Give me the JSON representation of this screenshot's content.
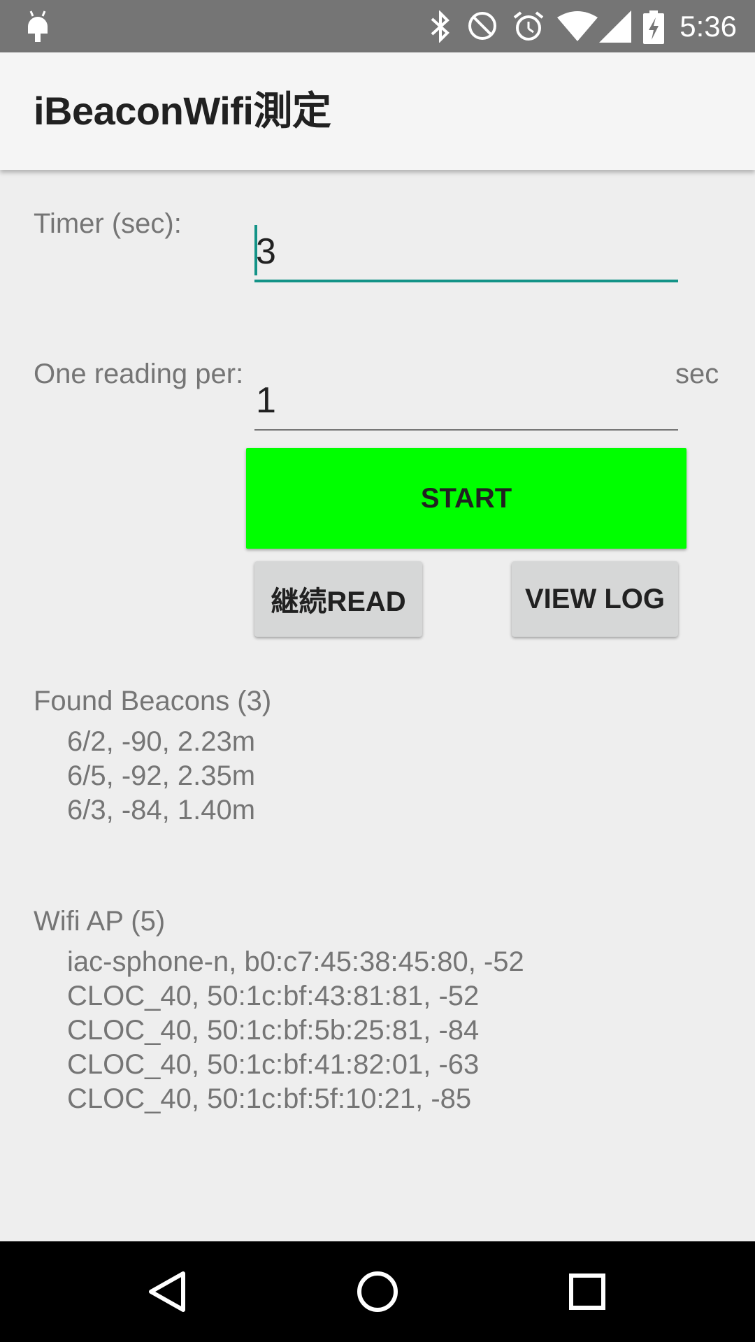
{
  "status_bar": {
    "time": "5:36",
    "icons": [
      "android-debug-icon",
      "bluetooth-icon",
      "do-not-disturb-icon",
      "alarm-icon",
      "wifi-icon",
      "cell-signal-icon",
      "battery-charging-icon"
    ]
  },
  "app_bar": {
    "title": "iBeaconWifi測定"
  },
  "form": {
    "timer_label": "Timer (sec):",
    "timer_value": "3",
    "reading_label": "One reading per:",
    "reading_value": "1",
    "reading_unit": "sec"
  },
  "buttons": {
    "start": "START",
    "continue_read": "継続READ",
    "view_log": "VIEW LOG"
  },
  "colors": {
    "start_button": "#00ff00",
    "accent": "#139387",
    "secondary_button": "#d6d7d7"
  },
  "beacons": {
    "title": "Found Beacons (3)",
    "items": [
      "6/2, -90, 2.23m",
      "6/5, -92, 2.35m",
      "6/3, -84, 1.40m"
    ]
  },
  "wifi": {
    "title": "Wifi AP (5)",
    "items": [
      "iac-sphone-n, b0:c7:45:38:45:80, -52",
      "CLOC_40, 50:1c:bf:43:81:81, -52",
      "CLOC_40, 50:1c:bf:5b:25:81, -84",
      "CLOC_40, 50:1c:bf:41:82:01, -63",
      "CLOC_40, 50:1c:bf:5f:10:21, -85"
    ]
  },
  "nav_bar": {
    "buttons": [
      "back-icon",
      "home-icon",
      "recents-icon"
    ]
  }
}
